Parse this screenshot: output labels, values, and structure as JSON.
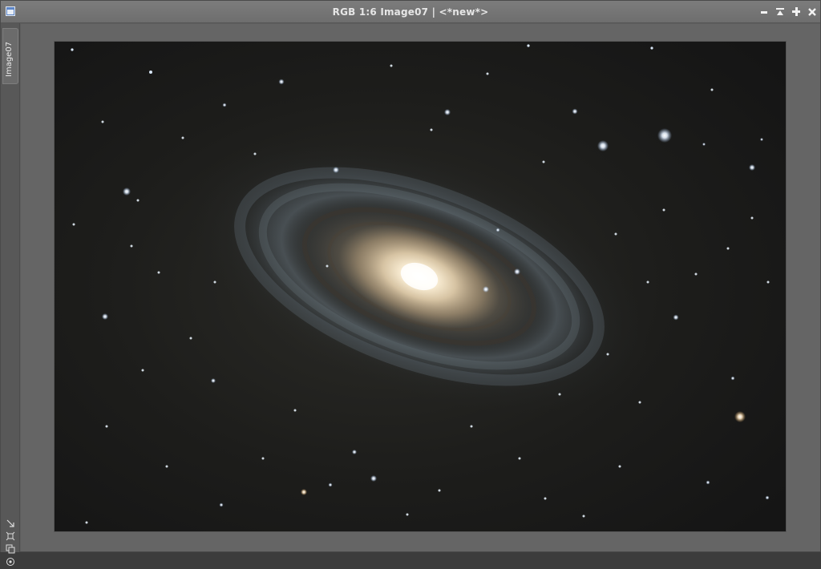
{
  "window": {
    "title": "RGB 1:6 Image07 | <*new*>",
    "app_icon": "image-window-icon"
  },
  "controls": {
    "minimize": "minimize-icon",
    "shade": "shade-icon",
    "maximize": "maximize-icon",
    "close": "close-icon"
  },
  "sidebar": {
    "view_tab": "Image07",
    "tools": [
      {
        "name": "zoom-to-fit-icon"
      },
      {
        "name": "fit-view-icon"
      },
      {
        "name": "clone-view-icon"
      },
      {
        "name": "target-icon"
      }
    ]
  },
  "image": {
    "subject": "galaxy-astrophoto"
  }
}
